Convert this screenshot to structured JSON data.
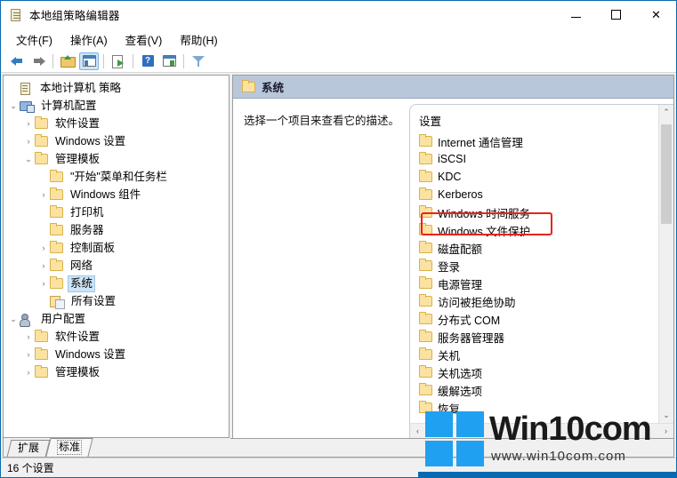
{
  "window": {
    "title": "本地组策略编辑器",
    "icon": "policy-document-icon",
    "minimize_label": "─",
    "maximize_label": "",
    "close_label": "✕"
  },
  "menu": [
    {
      "label": "文件(F)",
      "name": "menu-file"
    },
    {
      "label": "操作(A)",
      "name": "menu-action"
    },
    {
      "label": "查看(V)",
      "name": "menu-view"
    },
    {
      "label": "帮助(H)",
      "name": "menu-help"
    }
  ],
  "toolbar": [
    {
      "name": "back-button",
      "icon": "back-arrow-icon"
    },
    {
      "name": "forward-button",
      "icon": "forward-arrow-icon"
    },
    {
      "name": "up-one-level-button",
      "icon": "folder-up-icon"
    },
    {
      "name": "show-hide-tree-button",
      "icon": "tree-pane-icon",
      "active": true
    },
    {
      "name": "export-list-button",
      "icon": "export-icon"
    },
    {
      "name": "help-button",
      "icon": "help-icon"
    },
    {
      "name": "show-detail-pane-button",
      "icon": "detail-pane-icon"
    },
    {
      "name": "filter-button",
      "icon": "filter-icon"
    }
  ],
  "tree": {
    "root": {
      "label": "本地计算机 策略",
      "icon": "policy-document-icon"
    },
    "items": [
      {
        "label": "计算机配置",
        "icon": "computer-icon",
        "indent": 0,
        "chevron": "expanded"
      },
      {
        "label": "软件设置",
        "icon": "folder-icon",
        "indent": 1,
        "chevron": "collapsed"
      },
      {
        "label": "Windows 设置",
        "icon": "folder-icon",
        "indent": 1,
        "chevron": "collapsed"
      },
      {
        "label": "管理模板",
        "icon": "folder-icon",
        "indent": 1,
        "chevron": "expanded"
      },
      {
        "label": "\"开始\"菜单和任务栏",
        "icon": "folder-icon",
        "indent": 2,
        "chevron": "none"
      },
      {
        "label": "Windows 组件",
        "icon": "folder-icon",
        "indent": 2,
        "chevron": "collapsed"
      },
      {
        "label": "打印机",
        "icon": "folder-icon",
        "indent": 2,
        "chevron": "none"
      },
      {
        "label": "服务器",
        "icon": "folder-icon",
        "indent": 2,
        "chevron": "none"
      },
      {
        "label": "控制面板",
        "icon": "folder-icon",
        "indent": 2,
        "chevron": "collapsed"
      },
      {
        "label": "网络",
        "icon": "folder-icon",
        "indent": 2,
        "chevron": "collapsed"
      },
      {
        "label": "系统",
        "icon": "folder-icon",
        "indent": 2,
        "chevron": "collapsed",
        "selected": true
      },
      {
        "label": "所有设置",
        "icon": "all-settings-icon",
        "indent": 2,
        "chevron": "none"
      },
      {
        "label": "用户配置",
        "icon": "user-icon",
        "indent": 0,
        "chevron": "expanded"
      },
      {
        "label": "软件设置",
        "icon": "folder-icon",
        "indent": 1,
        "chevron": "collapsed"
      },
      {
        "label": "Windows 设置",
        "icon": "folder-icon",
        "indent": 1,
        "chevron": "collapsed"
      },
      {
        "label": "管理模板",
        "icon": "folder-icon",
        "indent": 1,
        "chevron": "collapsed"
      }
    ]
  },
  "pane": {
    "header_title": "系统",
    "header_icon": "folder-icon",
    "description": "选择一个项目来查看它的描述。",
    "list_heading": "设置",
    "list_items": [
      {
        "label": "Internet 通信管理",
        "icon": "folder-icon"
      },
      {
        "label": "iSCSI",
        "icon": "folder-icon"
      },
      {
        "label": "KDC",
        "icon": "folder-icon"
      },
      {
        "label": "Kerberos",
        "icon": "folder-icon"
      },
      {
        "label": "Windows 时间服务",
        "icon": "folder-icon"
      },
      {
        "label": "Windows 文件保护",
        "icon": "folder-icon",
        "highlighted": true
      },
      {
        "label": "磁盘配额",
        "icon": "folder-icon"
      },
      {
        "label": "登录",
        "icon": "folder-icon"
      },
      {
        "label": "电源管理",
        "icon": "folder-icon"
      },
      {
        "label": "访问被拒绝协助",
        "icon": "folder-icon"
      },
      {
        "label": "分布式 COM",
        "icon": "folder-icon"
      },
      {
        "label": "服务器管理器",
        "icon": "folder-icon"
      },
      {
        "label": "关机",
        "icon": "folder-icon"
      },
      {
        "label": "关机选项",
        "icon": "folder-icon"
      },
      {
        "label": "缓解选项",
        "icon": "folder-icon"
      },
      {
        "label": "恢复",
        "icon": "folder-icon"
      }
    ],
    "scroll_up_label": "⌃",
    "scroll_down_label": "⌄",
    "scroll_left_label": "‹",
    "scroll_right_label": "›"
  },
  "tabs": [
    {
      "label": "扩展",
      "name": "tab-extended",
      "active": false
    },
    {
      "label": "标准",
      "name": "tab-standard",
      "active": true
    }
  ],
  "status": {
    "text": "16 个设置"
  },
  "watermark": {
    "brand": "Win10com",
    "url": "www.win10com.com"
  },
  "colors": {
    "window_border": "#0a6ab0",
    "pane_header": "#b9c7da",
    "selection": "#cde3f6",
    "highlight_box": "#e8241b",
    "watermark_blue": "#20a0f0"
  }
}
